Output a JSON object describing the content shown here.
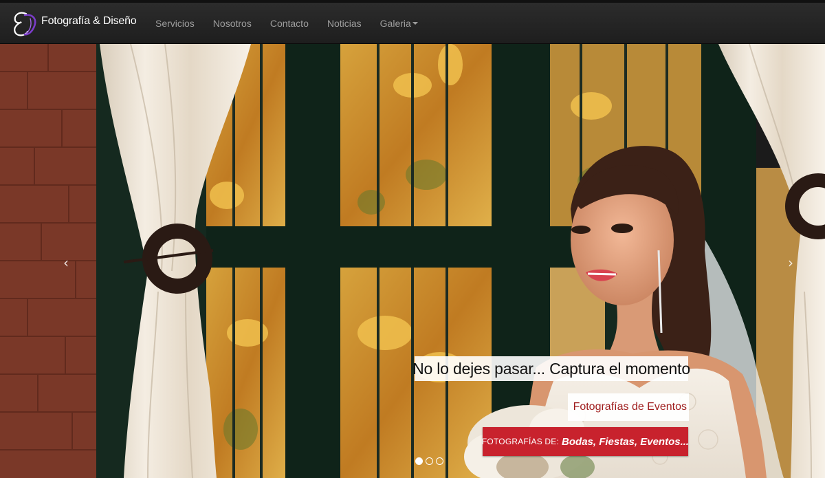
{
  "brand": {
    "name": "Fotografía & Diseño",
    "logo_icon": "ej-monogram-logo-icon"
  },
  "nav": {
    "items": [
      {
        "label": "Servicios"
      },
      {
        "label": "Nosotros"
      },
      {
        "label": "Contacto"
      },
      {
        "label": "Noticias"
      },
      {
        "label": "Galeria",
        "has_dropdown": true
      }
    ]
  },
  "carousel": {
    "prev_icon": "‹",
    "next_icon": "›",
    "caption": {
      "headline": "No lo dejes pasar... Captura el momento",
      "subtitle": "Fotografías de Eventos",
      "cta_prefix": "FOTOGRAFÍAS DE:",
      "cta_emphasis": "Bodas, Fiestas, Eventos..."
    },
    "slides_count": 3,
    "active_slide": 1
  },
  "colors": {
    "navbar": "#222222",
    "cta": "#c8222d",
    "subtitle_text": "#9e1b1b"
  }
}
